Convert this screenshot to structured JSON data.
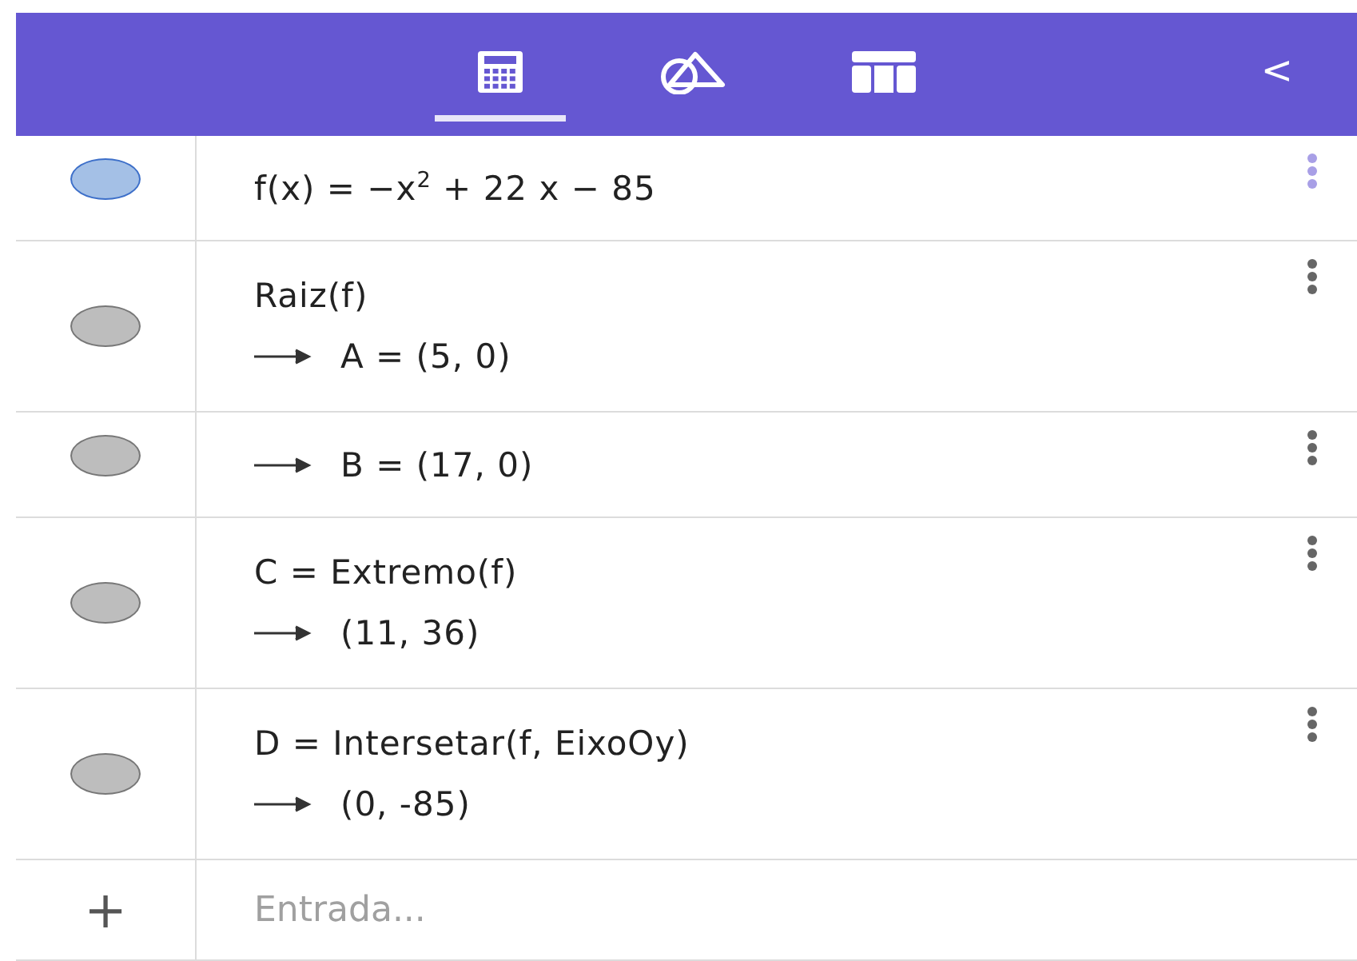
{
  "toolbar": {
    "tabs": [
      {
        "kind": "calculator",
        "selected": true
      },
      {
        "kind": "geometry",
        "selected": false
      },
      {
        "kind": "table",
        "selected": false
      }
    ],
    "collapse": "<"
  },
  "items": [
    {
      "color": "#a4c0e6",
      "selected": true,
      "input": "f(x) = −x$^{2}$ + 22 x − 85"
    },
    {
      "color": "#bdbdbd",
      "selected": false,
      "input": "Raiz(f)",
      "output": "A = (5, 0)"
    },
    {
      "color": "#bdbdbd",
      "selected": false,
      "output": "B = (17, 0)"
    },
    {
      "color": "#bdbdbd",
      "selected": false,
      "input": "C = Extremo(f)",
      "output": "(11, 36)"
    },
    {
      "color": "#bdbdbd",
      "selected": false,
      "input": "D = Intersetar(f, EixoOy)",
      "output": "(0, -85)"
    }
  ],
  "input_bar": {
    "add": "+",
    "placeholder": "Entrada..."
  }
}
